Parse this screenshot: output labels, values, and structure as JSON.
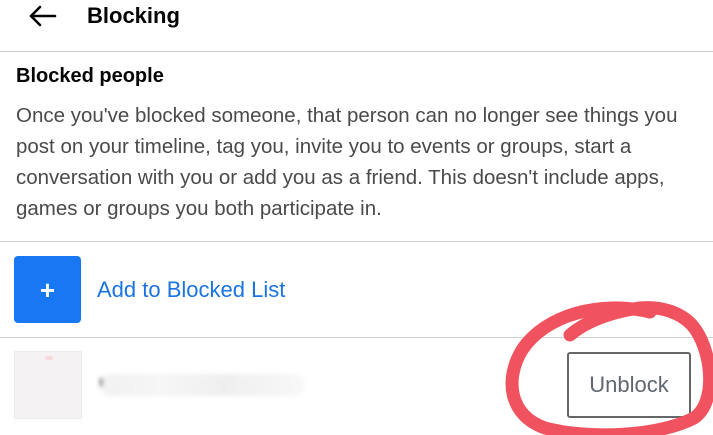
{
  "header": {
    "title": "Blocking"
  },
  "blocked_section": {
    "title": "Blocked people",
    "description": "Once you've blocked someone, that person can no longer see things you post on your timeline, tag you, invite you to events or groups, start a conversation with you or add you as a friend. This doesn't include apps, games or groups you both participate in."
  },
  "add_row": {
    "icon_glyph": "+",
    "label": "Add to Blocked List"
  },
  "blocked_list": [
    {
      "name": "",
      "action_label": "Unblock"
    }
  ],
  "colors": {
    "accent": "#1877f2",
    "link_text": "#1b74e4",
    "annotation": "#f0535f"
  },
  "icons": {
    "back": "arrow-left-icon",
    "add": "plus-icon"
  }
}
